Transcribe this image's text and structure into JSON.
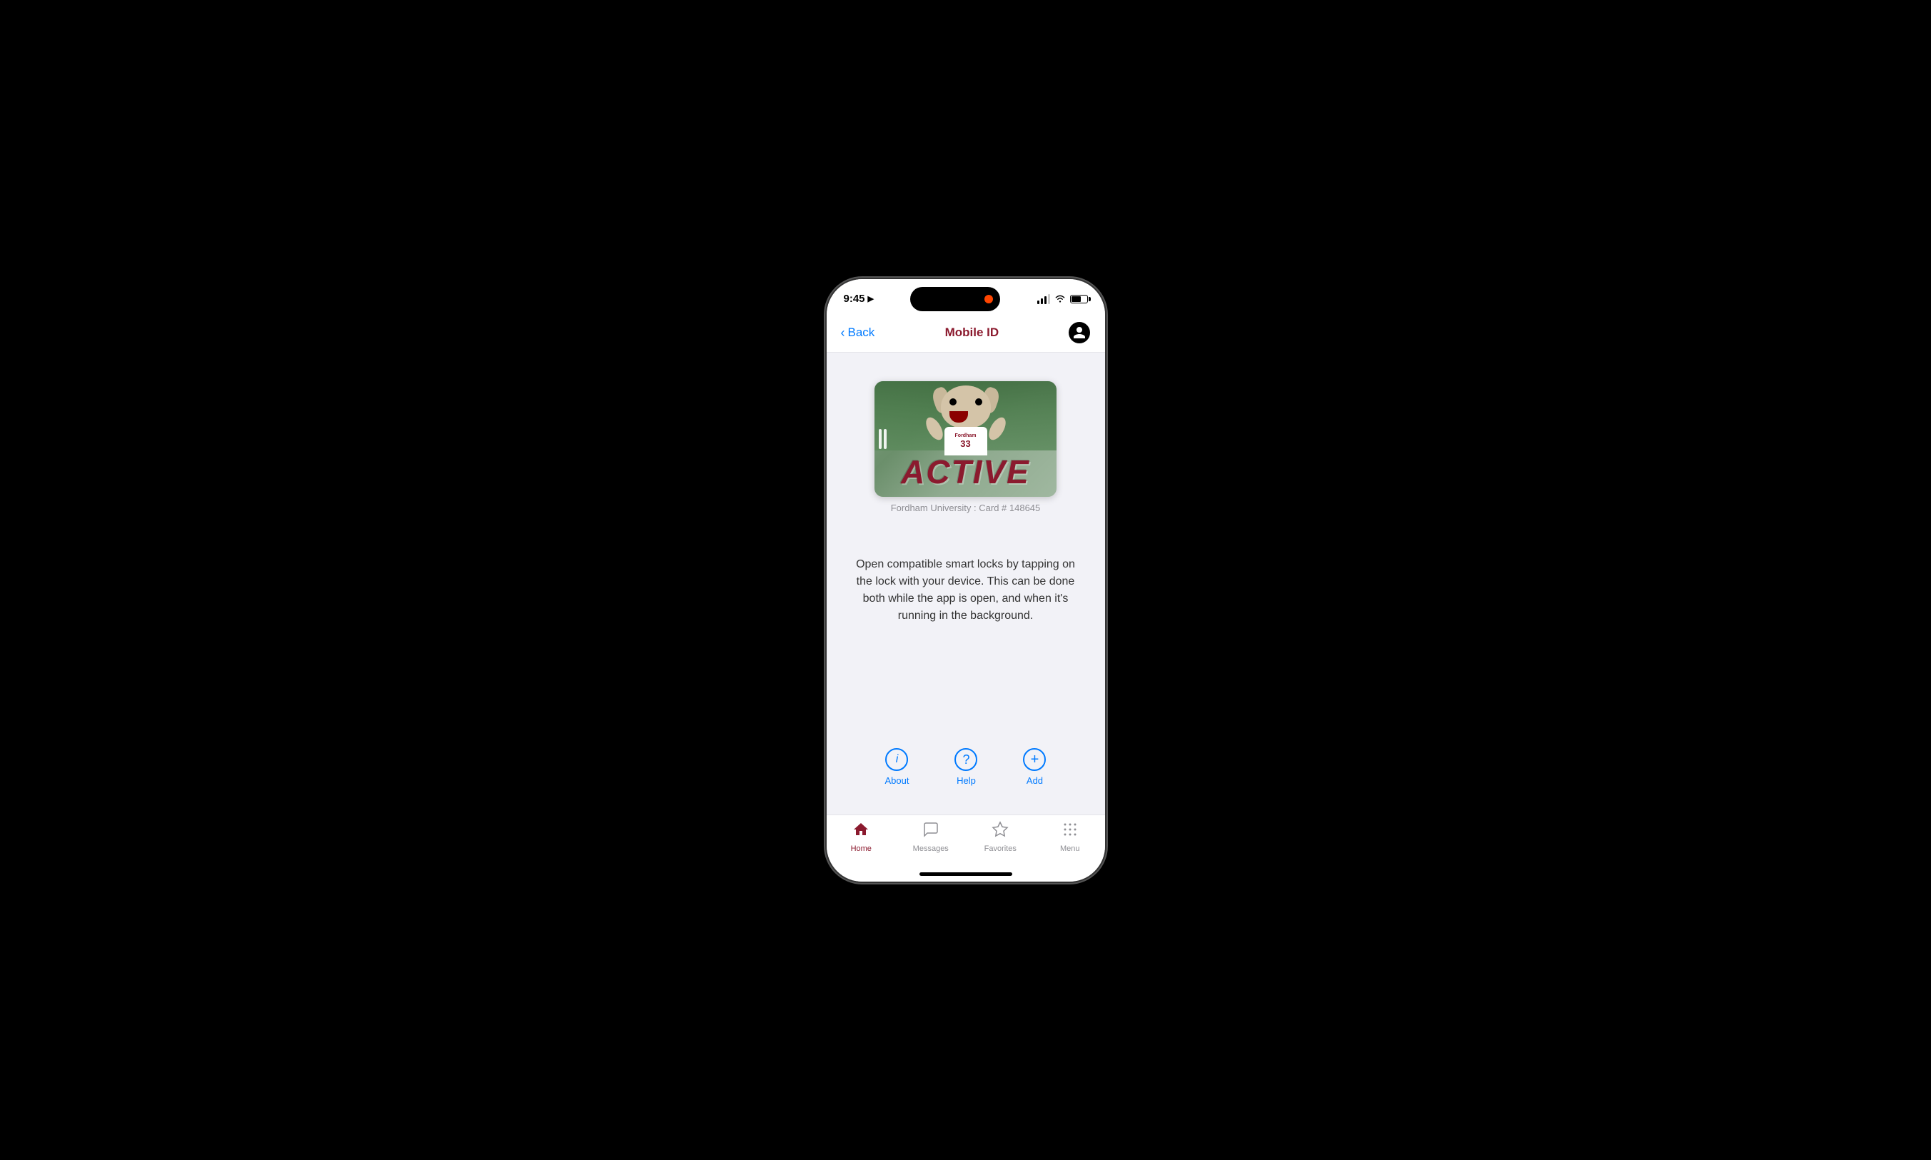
{
  "status_bar": {
    "time": "9:45",
    "arrow": "▶",
    "signal_label": "signal",
    "wifi_label": "wifi",
    "battery_label": "battery"
  },
  "nav": {
    "back_label": "Back",
    "title": "Mobile ID",
    "profile_icon": "person"
  },
  "card": {
    "active_text": "ACTIVE",
    "label": "Fordham University : Card # 148645",
    "university": "Fordham",
    "jersey_number": "33"
  },
  "description": "Open compatible smart locks by tapping on the lock with your device. This can be done both while the app is open, and when it's running in the background.",
  "actions": {
    "about": {
      "label": "About",
      "icon": "ℹ"
    },
    "help": {
      "label": "Help",
      "icon": "?"
    },
    "add": {
      "label": "Add",
      "icon": "+"
    }
  },
  "tabs": [
    {
      "id": "home",
      "label": "Home",
      "active": true
    },
    {
      "id": "messages",
      "label": "Messages",
      "active": false
    },
    {
      "id": "favorites",
      "label": "Favorites",
      "active": false
    },
    {
      "id": "menu",
      "label": "Menu",
      "active": false
    }
  ]
}
